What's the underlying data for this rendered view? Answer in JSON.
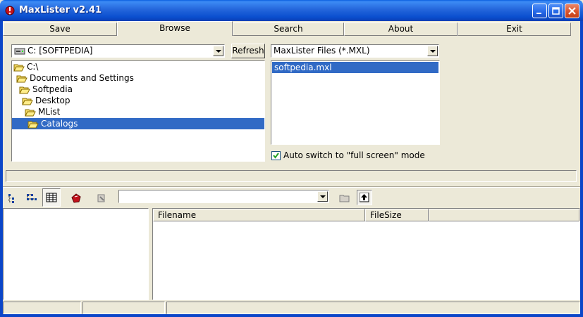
{
  "window": {
    "title": "MaxLister v2.41"
  },
  "tabs": [
    {
      "label": "Save"
    },
    {
      "label": "Browse"
    },
    {
      "label": "Search"
    },
    {
      "label": "About"
    },
    {
      "label": "Exit"
    }
  ],
  "browse": {
    "drive_value": "C: [SOFTPEDIA]",
    "refresh_label": "Refresh",
    "filter_value": "MaxLister Files (*.MXL)",
    "tree": [
      {
        "label": "C:\\"
      },
      {
        "label": "Documents and Settings"
      },
      {
        "label": "Softpedia"
      },
      {
        "label": "Desktop"
      },
      {
        "label": "MList"
      },
      {
        "label": "Catalogs"
      }
    ],
    "files": [
      {
        "label": "softpedia.mxl"
      }
    ],
    "auto_switch_label": "Auto switch to \"full screen\" mode",
    "auto_switch_checked": true
  },
  "list": {
    "columns": [
      {
        "label": "Filename"
      },
      {
        "label": "FileSize"
      }
    ]
  },
  "colors": {
    "selection": "#316ac5",
    "titlebar": "#0a4fcf",
    "face": "#ece9d8"
  }
}
